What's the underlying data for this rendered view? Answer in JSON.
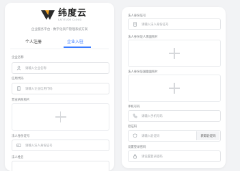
{
  "brand": {
    "name_cn": "纬度云",
    "name_en": "LATITUDE CLOUD"
  },
  "slogan": "企业服务平台 · 数字化资产管理系统方案",
  "tabs": {
    "personal": "个人注册",
    "company": "企业入驻"
  },
  "left_form": {
    "company_name": {
      "label": "企业名称",
      "placeholder": "请输入企业名称"
    },
    "credit_code": {
      "label": "信用代码",
      "placeholder": "请输入企业信用代码"
    },
    "license": {
      "label": "营业执照照片"
    },
    "legal_id_number": {
      "label": "法人身份证号",
      "placeholder": "请输入法人身份证号"
    },
    "legal_name_label": "法人姓名"
  },
  "right_form": {
    "legal_id": {
      "label": "法人身份证号",
      "placeholder": "请输入法人身份证号"
    },
    "id_front": {
      "label": "法人身份证人像面照片"
    },
    "id_back": {
      "label": "法人身份证国徽面照片"
    },
    "phone": {
      "label": "手机号码",
      "placeholder": "请输入手机号码"
    },
    "verify_code": {
      "label": "验证码",
      "placeholder": "请输入验证码",
      "action": "获取验证码"
    },
    "password": {
      "label": "设置登录密码",
      "placeholder": "请设置登录密码"
    }
  },
  "colors": {
    "accent": "#3a7bff",
    "logo": "#2b2b2b"
  }
}
